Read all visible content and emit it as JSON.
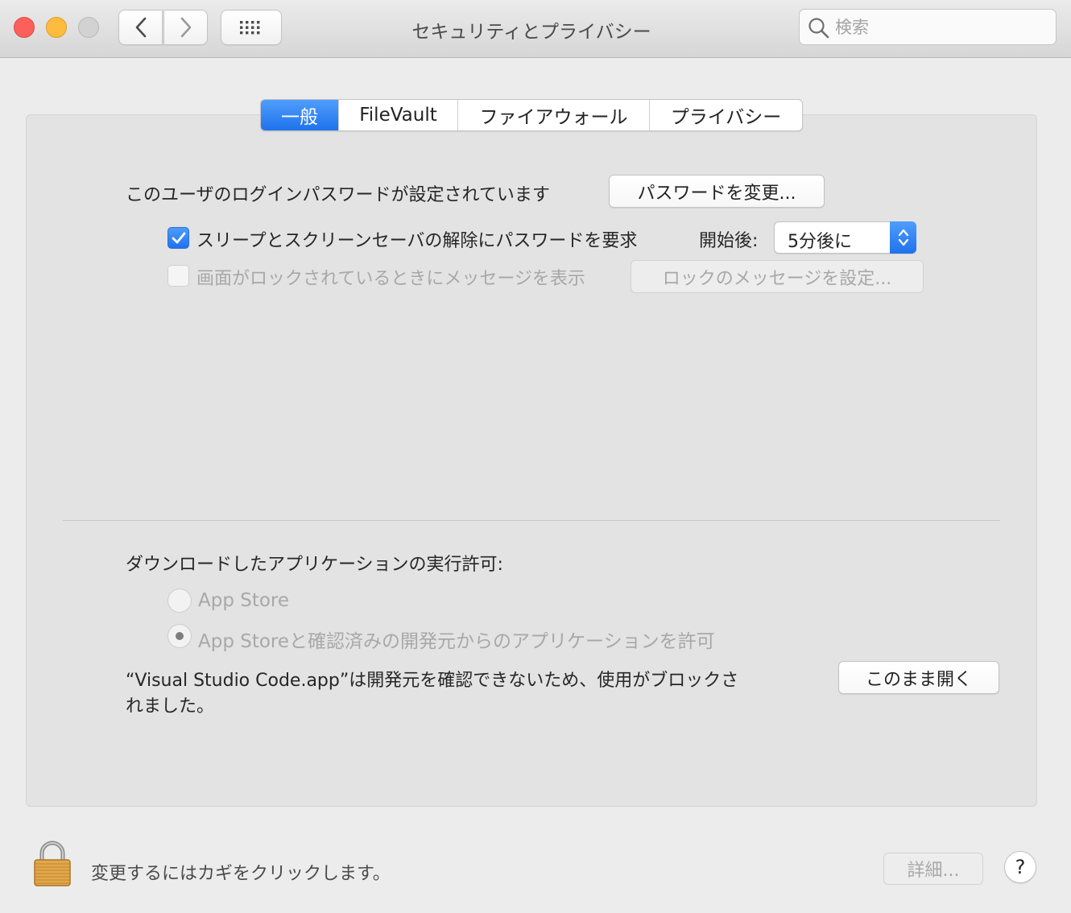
{
  "window": {
    "title": "セキュリティとプライバシー",
    "search_placeholder": "検索"
  },
  "tabs": [
    {
      "label": "一般",
      "active": true
    },
    {
      "label": "FileVault",
      "active": false
    },
    {
      "label": "ファイアウォール",
      "active": false
    },
    {
      "label": "プライバシー",
      "active": false
    }
  ],
  "general": {
    "password_status": "このユーザのログインパスワードが設定されています",
    "change_password_label": "パスワードを変更...",
    "require_password_label": "スリープとスクリーンセーバの解除にパスワードを要求",
    "require_password_checked": true,
    "after_label": "開始後:",
    "after_value": "5分後に",
    "lock_message_label": "画面がロックされているときにメッセージを表示",
    "lock_message_checked": false,
    "set_lock_message_label": "ロックのメッセージを設定..."
  },
  "downloads": {
    "heading": "ダウンロードしたアプリケーションの実行許可:",
    "options": [
      {
        "label": "App Store",
        "selected": false
      },
      {
        "label": "App Storeと確認済みの開発元からのアプリケーションを許可",
        "selected": true
      }
    ],
    "blocked_message_line1": "“Visual Studio Code.app”は開発元を確認できないため、使用がブロックさ",
    "blocked_message_line2": "れました。",
    "open_anyway_label": "このまま開く"
  },
  "footer": {
    "lock_text": "変更するにはカギをクリックします。",
    "advanced_label": "詳細...",
    "help_label": "?"
  },
  "colors": {
    "accent": "#2f7ff0",
    "panel": "#e3e3e3",
    "window": "#ececec"
  }
}
